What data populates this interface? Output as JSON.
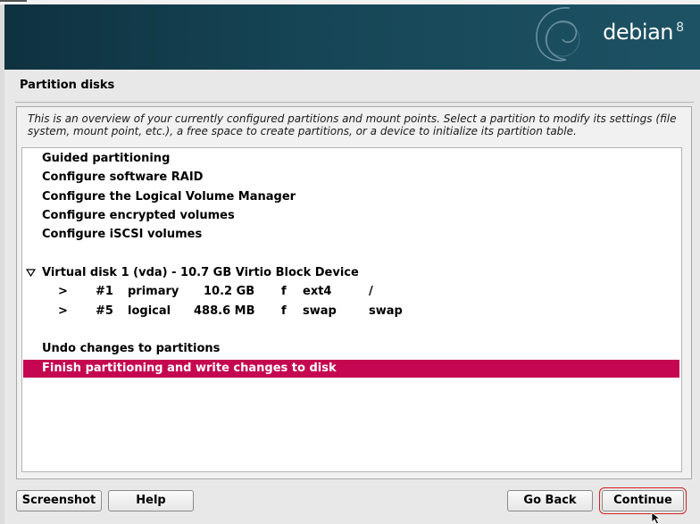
{
  "banner": {
    "logo_text": "debian",
    "logo_version": "8"
  },
  "page": {
    "title": "Partition disks",
    "description": "This is an overview of your currently configured partitions and mount points. Select a partition to modify its settings (file system, mount point, etc.), a free space to create partitions, or a device to initialize its partition table."
  },
  "menu": {
    "guided": "Guided partitioning",
    "raid": "Configure software RAID",
    "lvm": "Configure the Logical Volume Manager",
    "encrypted": "Configure encrypted volumes",
    "iscsi": "Configure iSCSI volumes",
    "disk": "Virtual disk 1 (vda) - 10.7 GB Virtio Block Device",
    "undo": "Undo changes to partitions",
    "finish": "Finish partitioning and write changes to disk"
  },
  "partitions": [
    {
      "arrow": ">",
      "number": "#1",
      "type": "primary",
      "size": "10.2 GB",
      "flag": "f",
      "fs": "ext4",
      "mount": "/"
    },
    {
      "arrow": ">",
      "number": "#5",
      "type": "logical",
      "size": "488.6 MB",
      "flag": "f",
      "fs": "swap",
      "mount": "swap"
    }
  ],
  "buttons": {
    "screenshot": "Screenshot",
    "help": "Help",
    "go_back": "Go Back",
    "continue": "Continue"
  },
  "colors": {
    "selection": "#c40750",
    "banner": "#164656",
    "focus_outline": "#d62020"
  }
}
